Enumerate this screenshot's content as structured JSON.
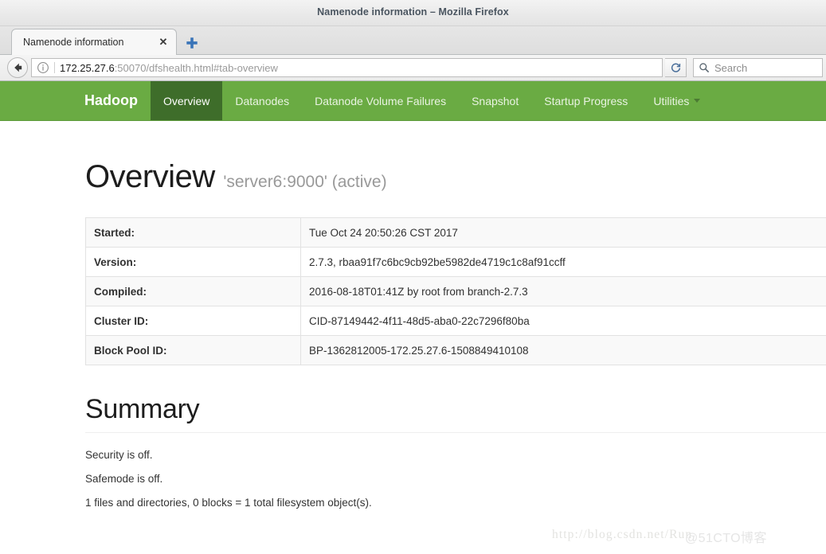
{
  "window": {
    "title": "Namenode information – Mozilla Firefox"
  },
  "browser": {
    "tab": {
      "label": "Namenode information",
      "close_glyph": "✕"
    },
    "newtab_label": "+",
    "url": {
      "host": "172.25.27.6",
      "path": ":50070/dfshealth.html#tab-overview"
    },
    "reload_glyph": "↻",
    "search": {
      "placeholder": "Search",
      "value": ""
    }
  },
  "hadoop_nav": {
    "brand": "Hadoop",
    "items": [
      {
        "label": "Overview",
        "active": true
      },
      {
        "label": "Datanodes",
        "active": false
      },
      {
        "label": "Datanode Volume Failures",
        "active": false
      },
      {
        "label": "Snapshot",
        "active": false
      },
      {
        "label": "Startup Progress",
        "active": false
      },
      {
        "label": "Utilities",
        "active": false,
        "has_caret": true
      }
    ],
    "colors": {
      "bar": "#6aab43",
      "active": "#3e6d2a",
      "text": "#ffffff"
    }
  },
  "page": {
    "overview_heading": "Overview",
    "overview_sub": "'server6:9000' (active)",
    "info_rows": [
      {
        "key": "Started:",
        "value": "Tue Oct 24 20:50:26 CST 2017"
      },
      {
        "key": "Version:",
        "value": "2.7.3, rbaa91f7c6bc9cb92be5982de4719c1c8af91ccff"
      },
      {
        "key": "Compiled:",
        "value": "2016-08-18T01:41Z by root from branch-2.7.3"
      },
      {
        "key": "Cluster ID:",
        "value": "CID-87149442-4f11-48d5-aba0-22c7296f80ba"
      },
      {
        "key": "Block Pool ID:",
        "value": "BP-1362812005-172.25.27.6-1508849410108"
      }
    ],
    "summary_heading": "Summary",
    "summary_lines": [
      "Security is off.",
      "Safemode is off.",
      "1 files and directories, 0 blocks = 1 total filesystem object(s)."
    ]
  },
  "watermarks": {
    "csdn": "http://blog.csdn.net/Run",
    "cto": "@51CTO博客"
  }
}
